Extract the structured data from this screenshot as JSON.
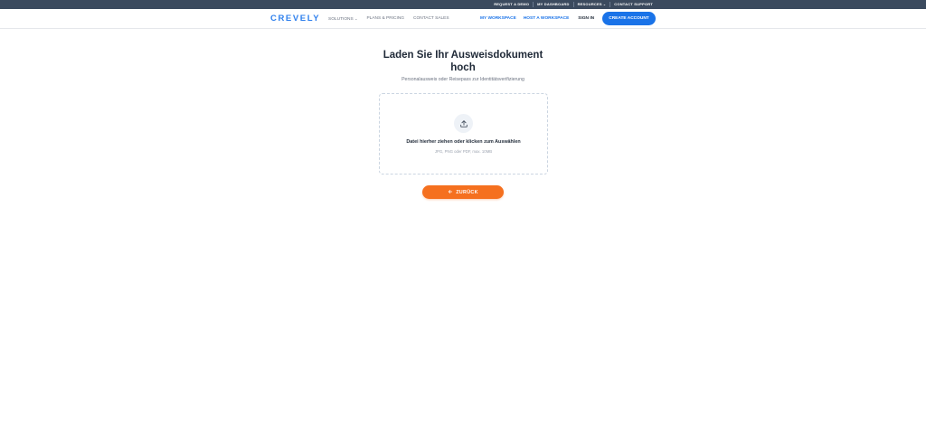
{
  "utility_bar": {
    "items": [
      {
        "label": "REQUEST A DEMO"
      },
      {
        "label": "MY DASHBOARD"
      },
      {
        "label": "RESOURCES",
        "has_dropdown": true
      },
      {
        "label": "CONTACT SUPPORT"
      }
    ]
  },
  "nav": {
    "logo": "CREVELY",
    "left_links": [
      {
        "label": "SOLUTIONS",
        "has_dropdown": true
      },
      {
        "label": "PLANS & PRICING"
      },
      {
        "label": "CONTACT SALES"
      }
    ],
    "right_links": [
      {
        "label": "MY WORKSPACE"
      },
      {
        "label": "HOST A WORKSPACE"
      },
      {
        "label": "SIGN IN"
      }
    ],
    "cta_label": "CREATE ACCOUNT"
  },
  "main": {
    "title": "Laden Sie Ihr Ausweisdokument hoch",
    "subtitle": "Personalausweis oder Reisepass zur Identitätsverifizierung",
    "dropzone": {
      "icon": "upload-icon",
      "primary_text": "Datei hierher ziehen oder klicken zum Auswählen",
      "secondary_text": "JPG, PNG oder PDF, max. 10MB"
    },
    "back_button": {
      "icon": "arrow-left-icon",
      "label": "ZURÜCK"
    }
  },
  "colors": {
    "utility_bar_bg": "#3b4a5e",
    "brand_blue": "#1a73e8",
    "logo_blue": "#2f80ed",
    "back_button_orange": "#f5701f"
  }
}
